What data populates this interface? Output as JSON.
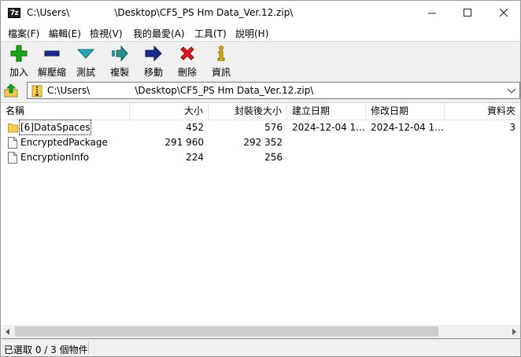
{
  "window": {
    "title": "C:\\Users\\               \\Desktop\\CF5_PS Hm Data_Ver.12.zip\\",
    "app_icon_text": "7z"
  },
  "menu": [
    "檔案(F)",
    "編輯(E)",
    "檢視(V)",
    "我的最愛(A)",
    "工具(T)",
    "說明(H)"
  ],
  "toolbar": {
    "add": "加入",
    "extract": "解壓縮",
    "test": "測試",
    "copy": "複製",
    "move": "移動",
    "delete": "刪除",
    "info": "資訊"
  },
  "address": {
    "path": "C:\\Users\\               \\Desktop\\CF5_PS Hm Data_Ver.12.zip\\"
  },
  "columns": {
    "name": "名稱",
    "size": "大小",
    "packed": "封裝後大小",
    "created": "建立日期",
    "modified": "修改日期",
    "folders": "資料夾"
  },
  "files": [
    {
      "name": "[6]DataSpaces",
      "type": "folder",
      "size": "452",
      "packed": "576",
      "created": "2024-12-04 1...",
      "modified": "2024-12-04 1...",
      "folders": "3"
    },
    {
      "name": "EncryptedPackage",
      "type": "file",
      "size": "291 960",
      "packed": "292 352",
      "created": "",
      "modified": "",
      "folders": ""
    },
    {
      "name": "EncryptionInfo",
      "type": "file",
      "size": "224",
      "packed": "256",
      "created": "",
      "modified": "",
      "folders": ""
    }
  ],
  "status": {
    "selection": "已選取 0 / 3 個物件"
  },
  "colors": {
    "toolbar_bg": "#f0f0f0",
    "folder_yellow": "#f3cd5a",
    "add_green": "#1aa51a",
    "delete_red": "#e0161d",
    "navy": "#1c2a8a",
    "teal": "#2aa3b3"
  }
}
